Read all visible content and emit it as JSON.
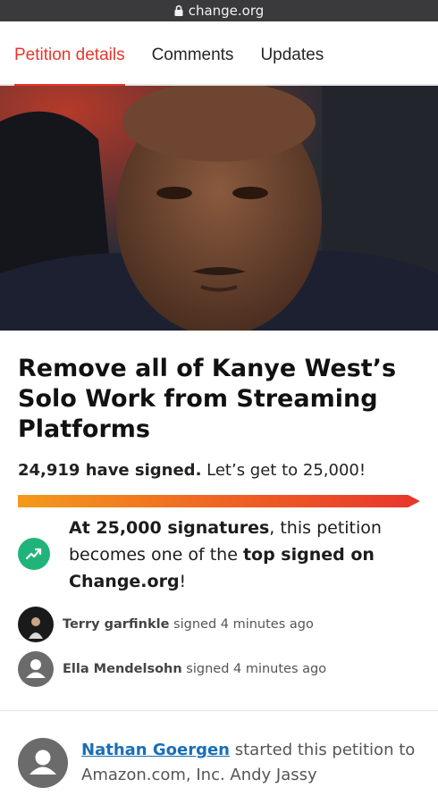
{
  "browser": {
    "url": "change.org"
  },
  "tabs": [
    {
      "label": "Petition details",
      "active": true
    },
    {
      "label": "Comments"
    },
    {
      "label": "Updates"
    }
  ],
  "petition": {
    "title": "Remove all of Kanye West’s Solo Work from Streaming Platforms",
    "signed_count": "24,919 have signed.",
    "goal_text": " Let’s get to 25,000!",
    "progress_fraction": 0.9968,
    "milestone": {
      "part1": "At 25,000 signatures",
      "part2": ", this petition becomes one of the ",
      "part3": "top signed on Change.org",
      "part4": "!"
    }
  },
  "recent_signers": [
    {
      "name": "Terry garfinkle",
      "action": " signed 4 minutes ago"
    },
    {
      "name": "Ella Mendelsohn",
      "action": " signed 4 minutes ago"
    }
  ],
  "starter": {
    "name": "Nathan Goergen",
    "text": " started this petition to Amazon.com, Inc. Andy Jassy"
  },
  "colors": {
    "accent": "#e8352c",
    "goal_icon": "#21b47a",
    "link": "#1a6fb5"
  }
}
